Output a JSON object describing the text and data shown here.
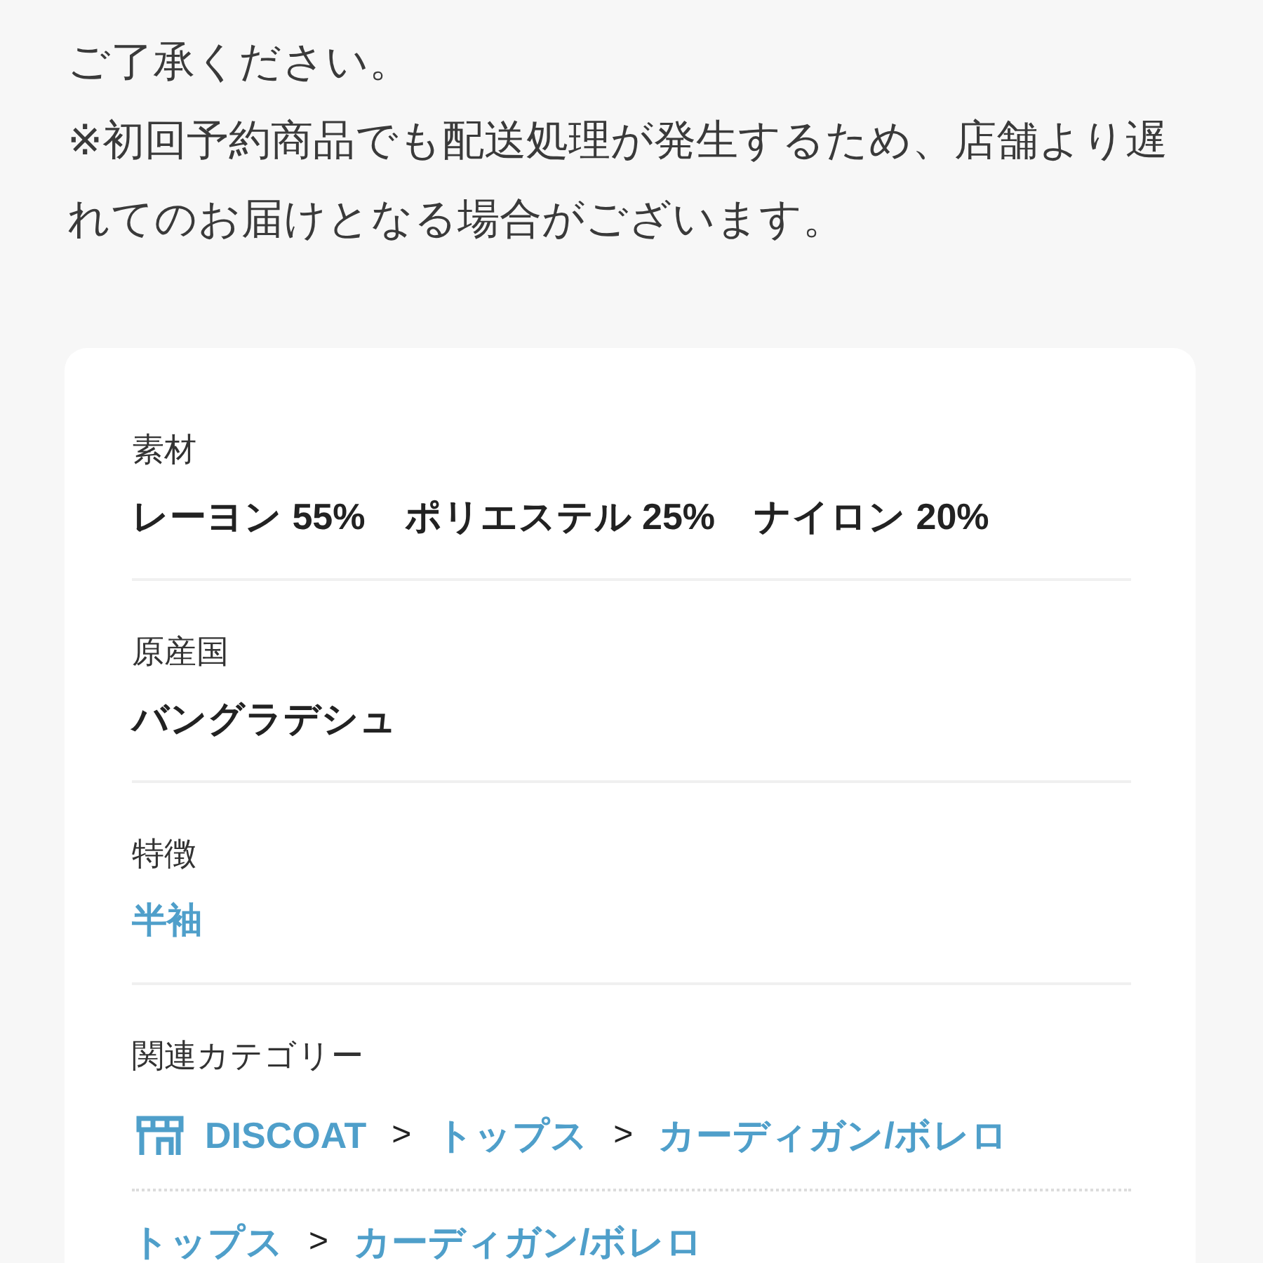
{
  "notice": {
    "paragraphs": [
      "ご了承ください。",
      "※初回予約商品でも配送処理が発生するため、店舗より遅れてのお届けとなる場合がございます。"
    ]
  },
  "spec": {
    "rows": [
      {
        "label": "素材",
        "kind": "text",
        "values": [
          "レーヨン 55%",
          "ポリエステル 25%",
          "ナイロン 20%"
        ]
      },
      {
        "label": "原産国",
        "kind": "text",
        "values": [
          "バングラデシュ"
        ]
      },
      {
        "label": "特徴",
        "kind": "link",
        "values": [
          "半袖"
        ]
      },
      {
        "label": "関連カテゴリー",
        "kind": "breadcrumbs",
        "paths": [
          {
            "shop_icon": true,
            "crumbs": [
              "DISCOAT",
              "トップス",
              "カーディガン/ボレロ"
            ],
            "separators": [
              ">",
              ">"
            ]
          },
          {
            "shop_icon": false,
            "crumbs": [
              "トップス",
              "カーディガン/ボレロ"
            ],
            "separators": [
              ">"
            ]
          }
        ]
      }
    ]
  }
}
